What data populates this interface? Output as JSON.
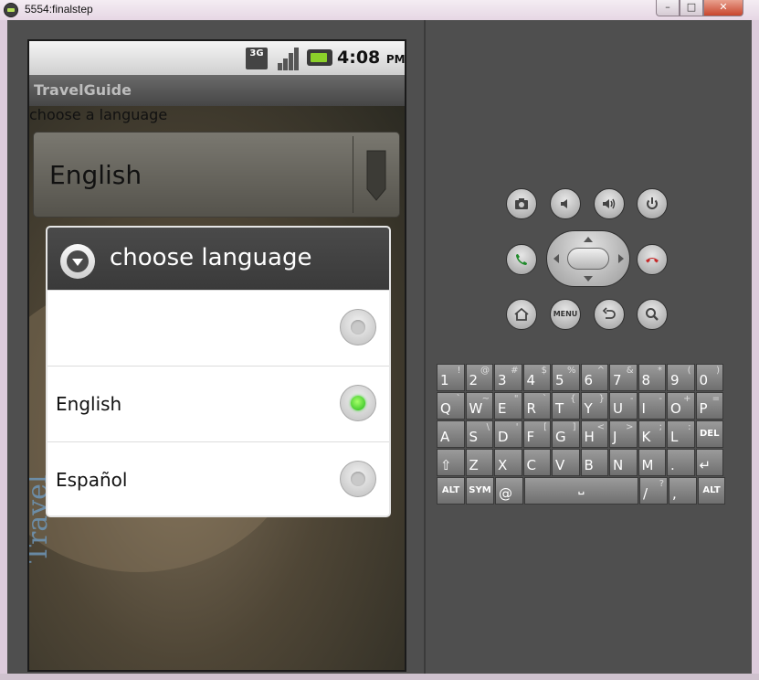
{
  "window": {
    "title": "5554:finalstep",
    "minimize_label": "–",
    "maximize_label": "□",
    "close_label": "✕"
  },
  "status_bar": {
    "network_label": "3G",
    "time": "4:08",
    "ampm": "PM"
  },
  "app": {
    "title": "TravelGuide",
    "watermark": "Travel",
    "prompt_label": "choose a language",
    "spinner_value": "English"
  },
  "dialog": {
    "title": "choose language",
    "options": [
      {
        "label": "",
        "checked": false
      },
      {
        "label": "English",
        "checked": true
      },
      {
        "label": "Español",
        "checked": false
      }
    ]
  },
  "hardware": {
    "menu_label": "MENU"
  },
  "keyboard": {
    "rows": [
      [
        [
          "1",
          "!"
        ],
        [
          "2",
          "@"
        ],
        [
          "3",
          "#"
        ],
        [
          "4",
          "$"
        ],
        [
          "5",
          "%"
        ],
        [
          "6",
          "^"
        ],
        [
          "7",
          "&"
        ],
        [
          "8",
          "*"
        ],
        [
          "9",
          "("
        ],
        [
          "0",
          ")"
        ]
      ],
      [
        [
          "Q",
          "`"
        ],
        [
          "W",
          "~"
        ],
        [
          "E",
          "\""
        ],
        [
          "R",
          "`"
        ],
        [
          "T",
          "{"
        ],
        [
          "Y",
          "}"
        ],
        [
          "U",
          "-"
        ],
        [
          "I",
          "-"
        ],
        [
          "O",
          "+"
        ],
        [
          "P",
          "="
        ]
      ],
      [
        [
          "A",
          ""
        ],
        [
          "S",
          "\\"
        ],
        [
          "D",
          "'"
        ],
        [
          "F",
          "["
        ],
        [
          "G",
          "]"
        ],
        [
          "H",
          "<"
        ],
        [
          "J",
          ">"
        ],
        [
          "K",
          ";"
        ],
        [
          "L",
          ":"
        ],
        [
          "DEL",
          ""
        ]
      ],
      [
        [
          "⇧",
          ""
        ],
        [
          "Z",
          ""
        ],
        [
          "X",
          ""
        ],
        [
          "C",
          ""
        ],
        [
          "V",
          ""
        ],
        [
          "B",
          ""
        ],
        [
          "N",
          ""
        ],
        [
          "M",
          ""
        ],
        [
          ".",
          ""
        ],
        [
          "↵",
          ""
        ]
      ],
      [
        [
          "ALT",
          ""
        ],
        [
          "SYM",
          ""
        ],
        [
          "@",
          ""
        ],
        [
          "SPACE",
          ""
        ],
        [
          "/",
          "?"
        ],
        [
          ",",
          ""
        ],
        [
          "ALT",
          ""
        ]
      ]
    ]
  }
}
